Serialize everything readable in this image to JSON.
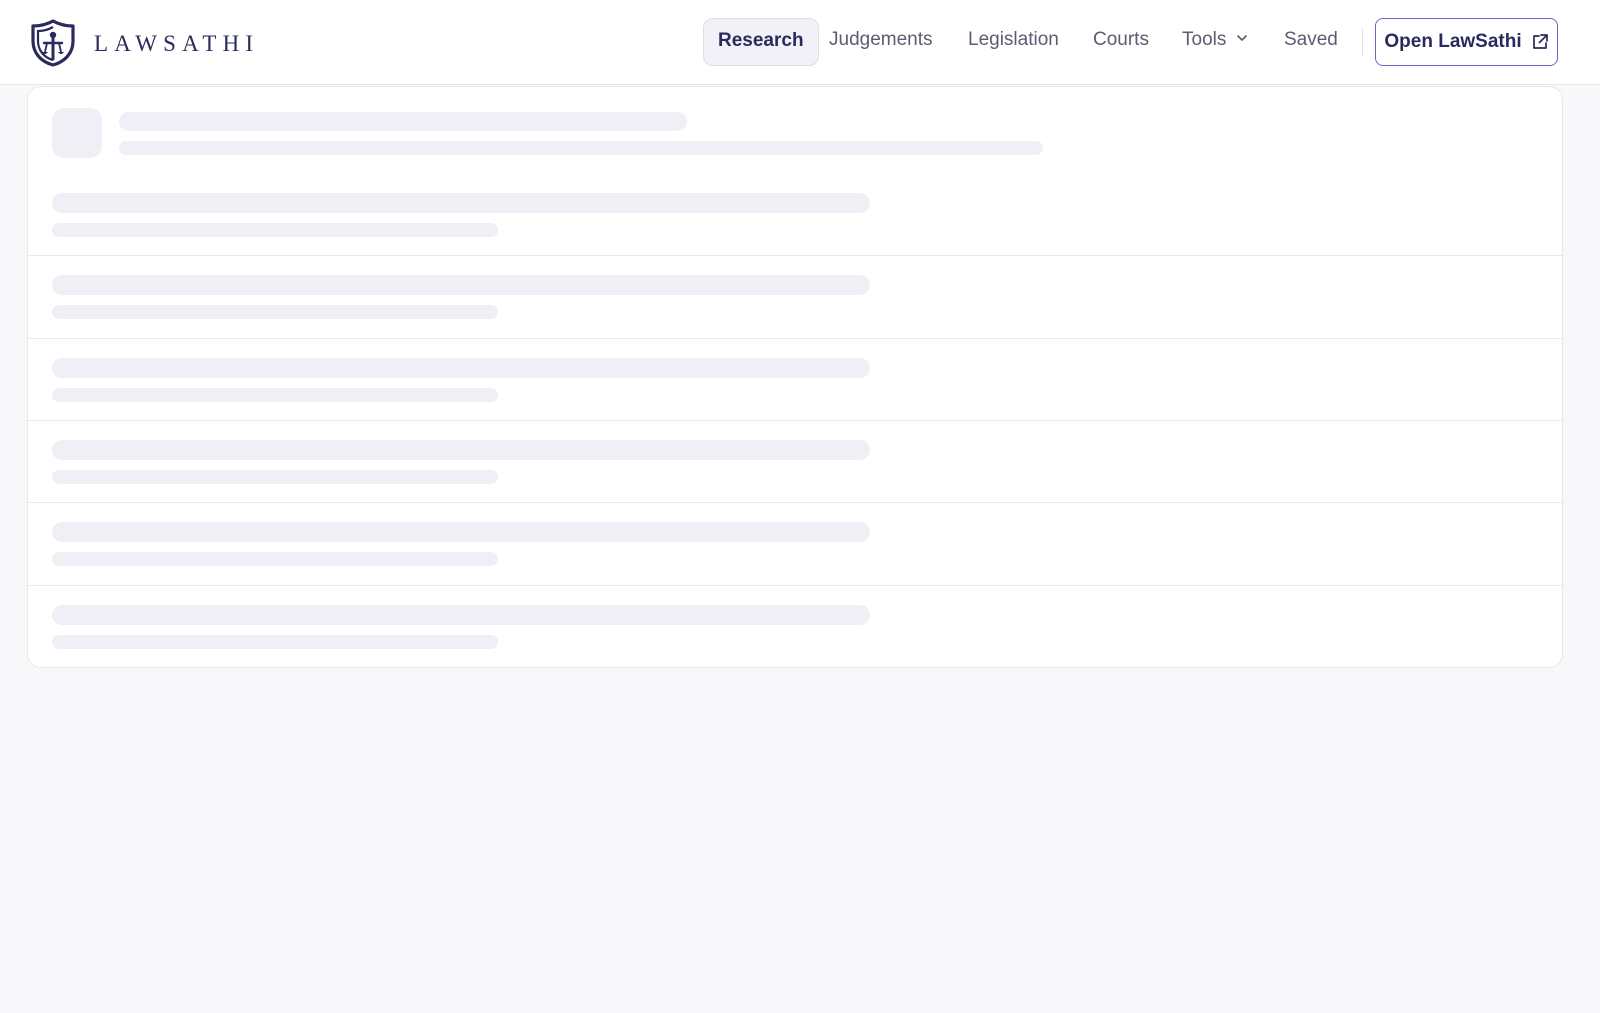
{
  "brand": {
    "name": "LAWSATHI"
  },
  "nav": {
    "items": [
      {
        "label": "Research",
        "active": true
      },
      {
        "label": "Judgements",
        "active": false
      },
      {
        "label": "Legislation",
        "active": false
      },
      {
        "label": "Courts",
        "active": false
      },
      {
        "label": "Tools",
        "active": false,
        "has_dropdown": true
      },
      {
        "label": "Saved",
        "active": false
      }
    ],
    "open_button": {
      "label": "Open LawSathi",
      "icon": "external-link-icon"
    }
  },
  "content": {
    "state": "loading",
    "skeleton_rows": 6
  },
  "colors": {
    "brand": "#2b2a5c",
    "accent": "#6c67c9",
    "skeleton": "#f0eff5",
    "background": "#f8f8fa"
  }
}
